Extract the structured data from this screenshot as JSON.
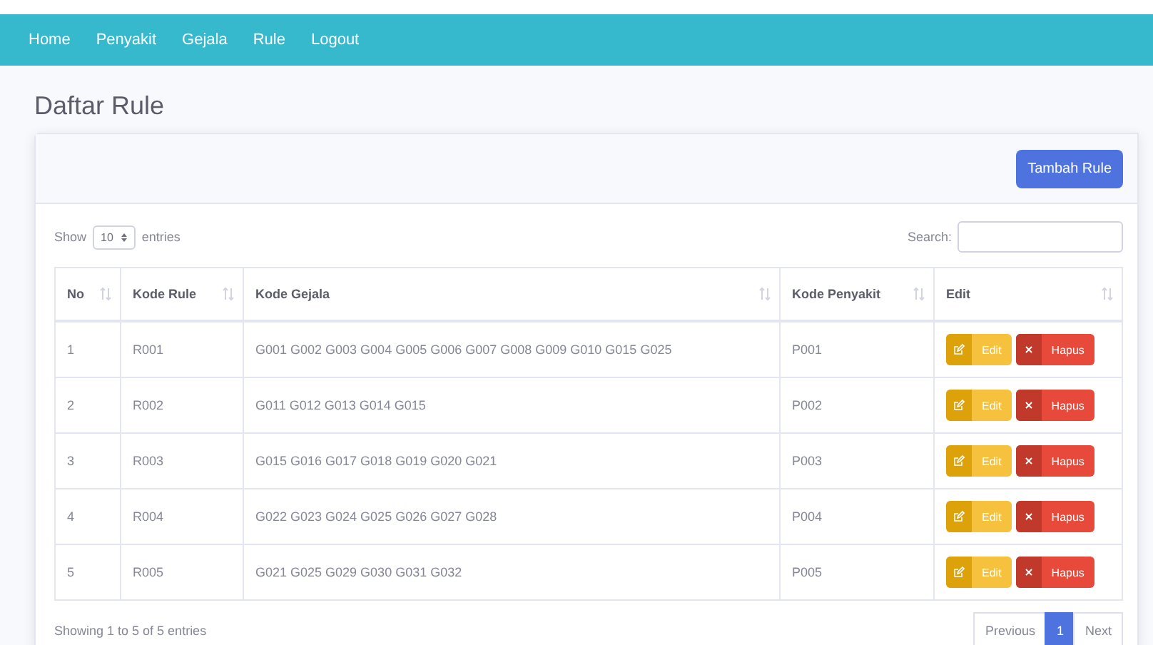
{
  "navbar": {
    "items": [
      {
        "label": "Home"
      },
      {
        "label": "Penyakit"
      },
      {
        "label": "Gejala"
      },
      {
        "label": "Rule"
      },
      {
        "label": "Logout"
      }
    ]
  },
  "title": "Daftar Rule",
  "add_button": "Tambah Rule",
  "length_control": {
    "before": "Show",
    "value": "10",
    "after": "entries"
  },
  "search": {
    "label": "Search:"
  },
  "table": {
    "columns": [
      "No",
      "Kode Rule",
      "Kode Gejala",
      "Kode Penyakit",
      "Edit"
    ],
    "rows": [
      {
        "no": "1",
        "rule": "R001",
        "gejala": "G001 G002 G003 G004 G005 G006 G007 G008 G009 G010 G015 G025",
        "penyakit": "P001",
        "edit": "Edit",
        "delete": "Hapus"
      },
      {
        "no": "2",
        "rule": "R002",
        "gejala": "G011 G012 G013 G014 G015",
        "penyakit": "P002",
        "edit": "Edit",
        "delete": "Hapus"
      },
      {
        "no": "3",
        "rule": "R003",
        "gejala": "G015 G016 G017 G018 G019 G020 G021",
        "penyakit": "P003",
        "edit": "Edit",
        "delete": "Hapus"
      },
      {
        "no": "4",
        "rule": "R004",
        "gejala": "G022 G023 G024 G025 G026 G027 G028",
        "penyakit": "P004",
        "edit": "Edit",
        "delete": "Hapus"
      },
      {
        "no": "5",
        "rule": "R005",
        "gejala": "G021 G025 G029 G030 G031 G032",
        "penyakit": "P005",
        "edit": "Edit",
        "delete": "Hapus"
      }
    ]
  },
  "info": "Showing 1 to 5 of 5 entries",
  "pagination": [
    {
      "label": "Previous",
      "selected": false
    },
    {
      "label": "1",
      "selected": true
    },
    {
      "label": "Next",
      "selected": false
    }
  ]
}
